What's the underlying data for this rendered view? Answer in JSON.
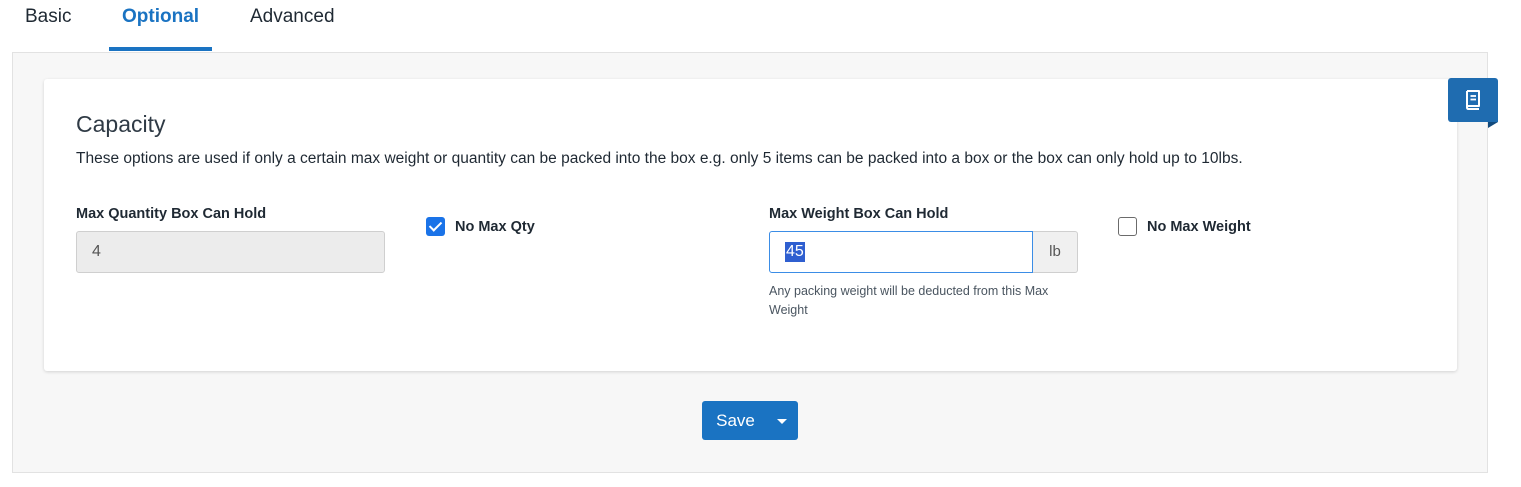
{
  "tabs": {
    "basic": "Basic",
    "optional": "Optional",
    "advanced": "Advanced"
  },
  "capacity": {
    "title": "Capacity",
    "description": "These options are used if only a certain max weight or quantity can be packed into the box e.g. only 5 items can be packed into a box or the box can only hold up to 10lbs.",
    "max_qty_label": "Max Quantity Box Can Hold",
    "max_qty_value": "4",
    "no_max_qty_label": "No Max Qty",
    "no_max_qty_checked": true,
    "max_weight_label": "Max Weight Box Can Hold",
    "max_weight_value": "45",
    "weight_unit": "lb",
    "weight_help": "Any packing weight will be deducted from this Max Weight",
    "no_max_weight_label": "No Max Weight",
    "no_max_weight_checked": false
  },
  "actions": {
    "save_label": "Save"
  },
  "side_tab": {
    "icon": "book-icon"
  },
  "colors": {
    "accent": "#1a73c2",
    "checkbox_blue": "#1a73e8",
    "side_tab": "#1f6cb0"
  }
}
